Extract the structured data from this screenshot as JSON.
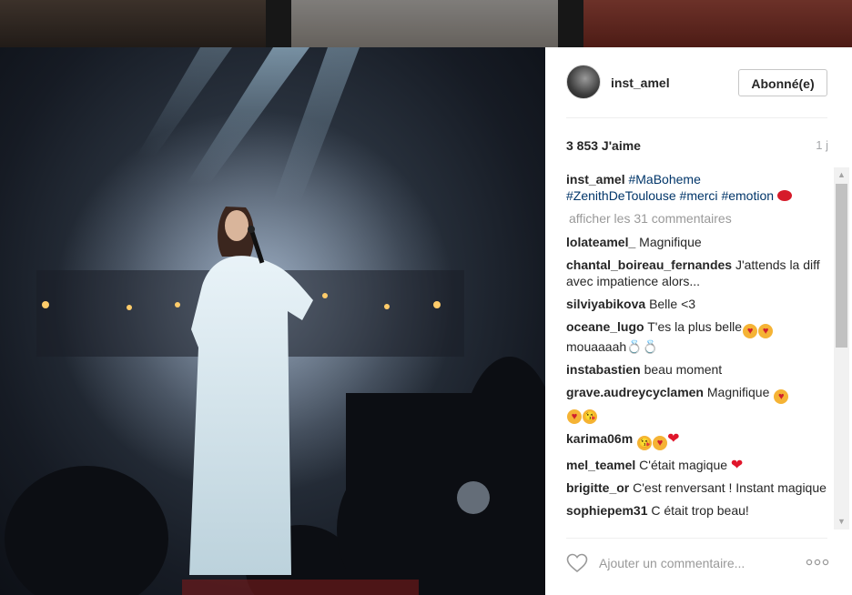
{
  "post": {
    "username": "inst_amel",
    "follow_label": "Abonné(e)",
    "likes": "3 853 J'aime",
    "age": "1 j",
    "caption_user": "inst_amel",
    "caption_tags": [
      "#MaBoheme",
      "#ZenithDeToulouse",
      "#merci",
      "#emotion"
    ],
    "more_comments": "afficher les 31 commentaires",
    "add_comment_placeholder": "Ajouter un commentaire..."
  },
  "comments": [
    {
      "user": "lolateamel_",
      "text": "Magnifique"
    },
    {
      "user": "chantal_boireau_fernandes",
      "text": "J'attends la diff avec impatience alors..."
    },
    {
      "user": "silviyabikova",
      "text": "Belle <3"
    },
    {
      "user": "oceane_lugo",
      "text": "T'es la plus belle",
      "text2": "mouaaaah"
    },
    {
      "user": "instabastien",
      "text": "beau moment"
    },
    {
      "user": "grave.audreycyclamen",
      "text": "Magnifique"
    },
    {
      "user": "karima06m",
      "text": ""
    },
    {
      "user": "mel_teamel",
      "text": "C'était magique"
    },
    {
      "user": "brigitte_or",
      "text": "C'est renversant ! Instant magique"
    },
    {
      "user": "sophiepem31",
      "text": "C était trop beau!"
    }
  ],
  "icons": {
    "like": "heart-outline-icon",
    "options": "ellipsis-icon"
  },
  "colors": {
    "hashtag": "#003569",
    "text": "#262626",
    "muted": "#999999"
  }
}
